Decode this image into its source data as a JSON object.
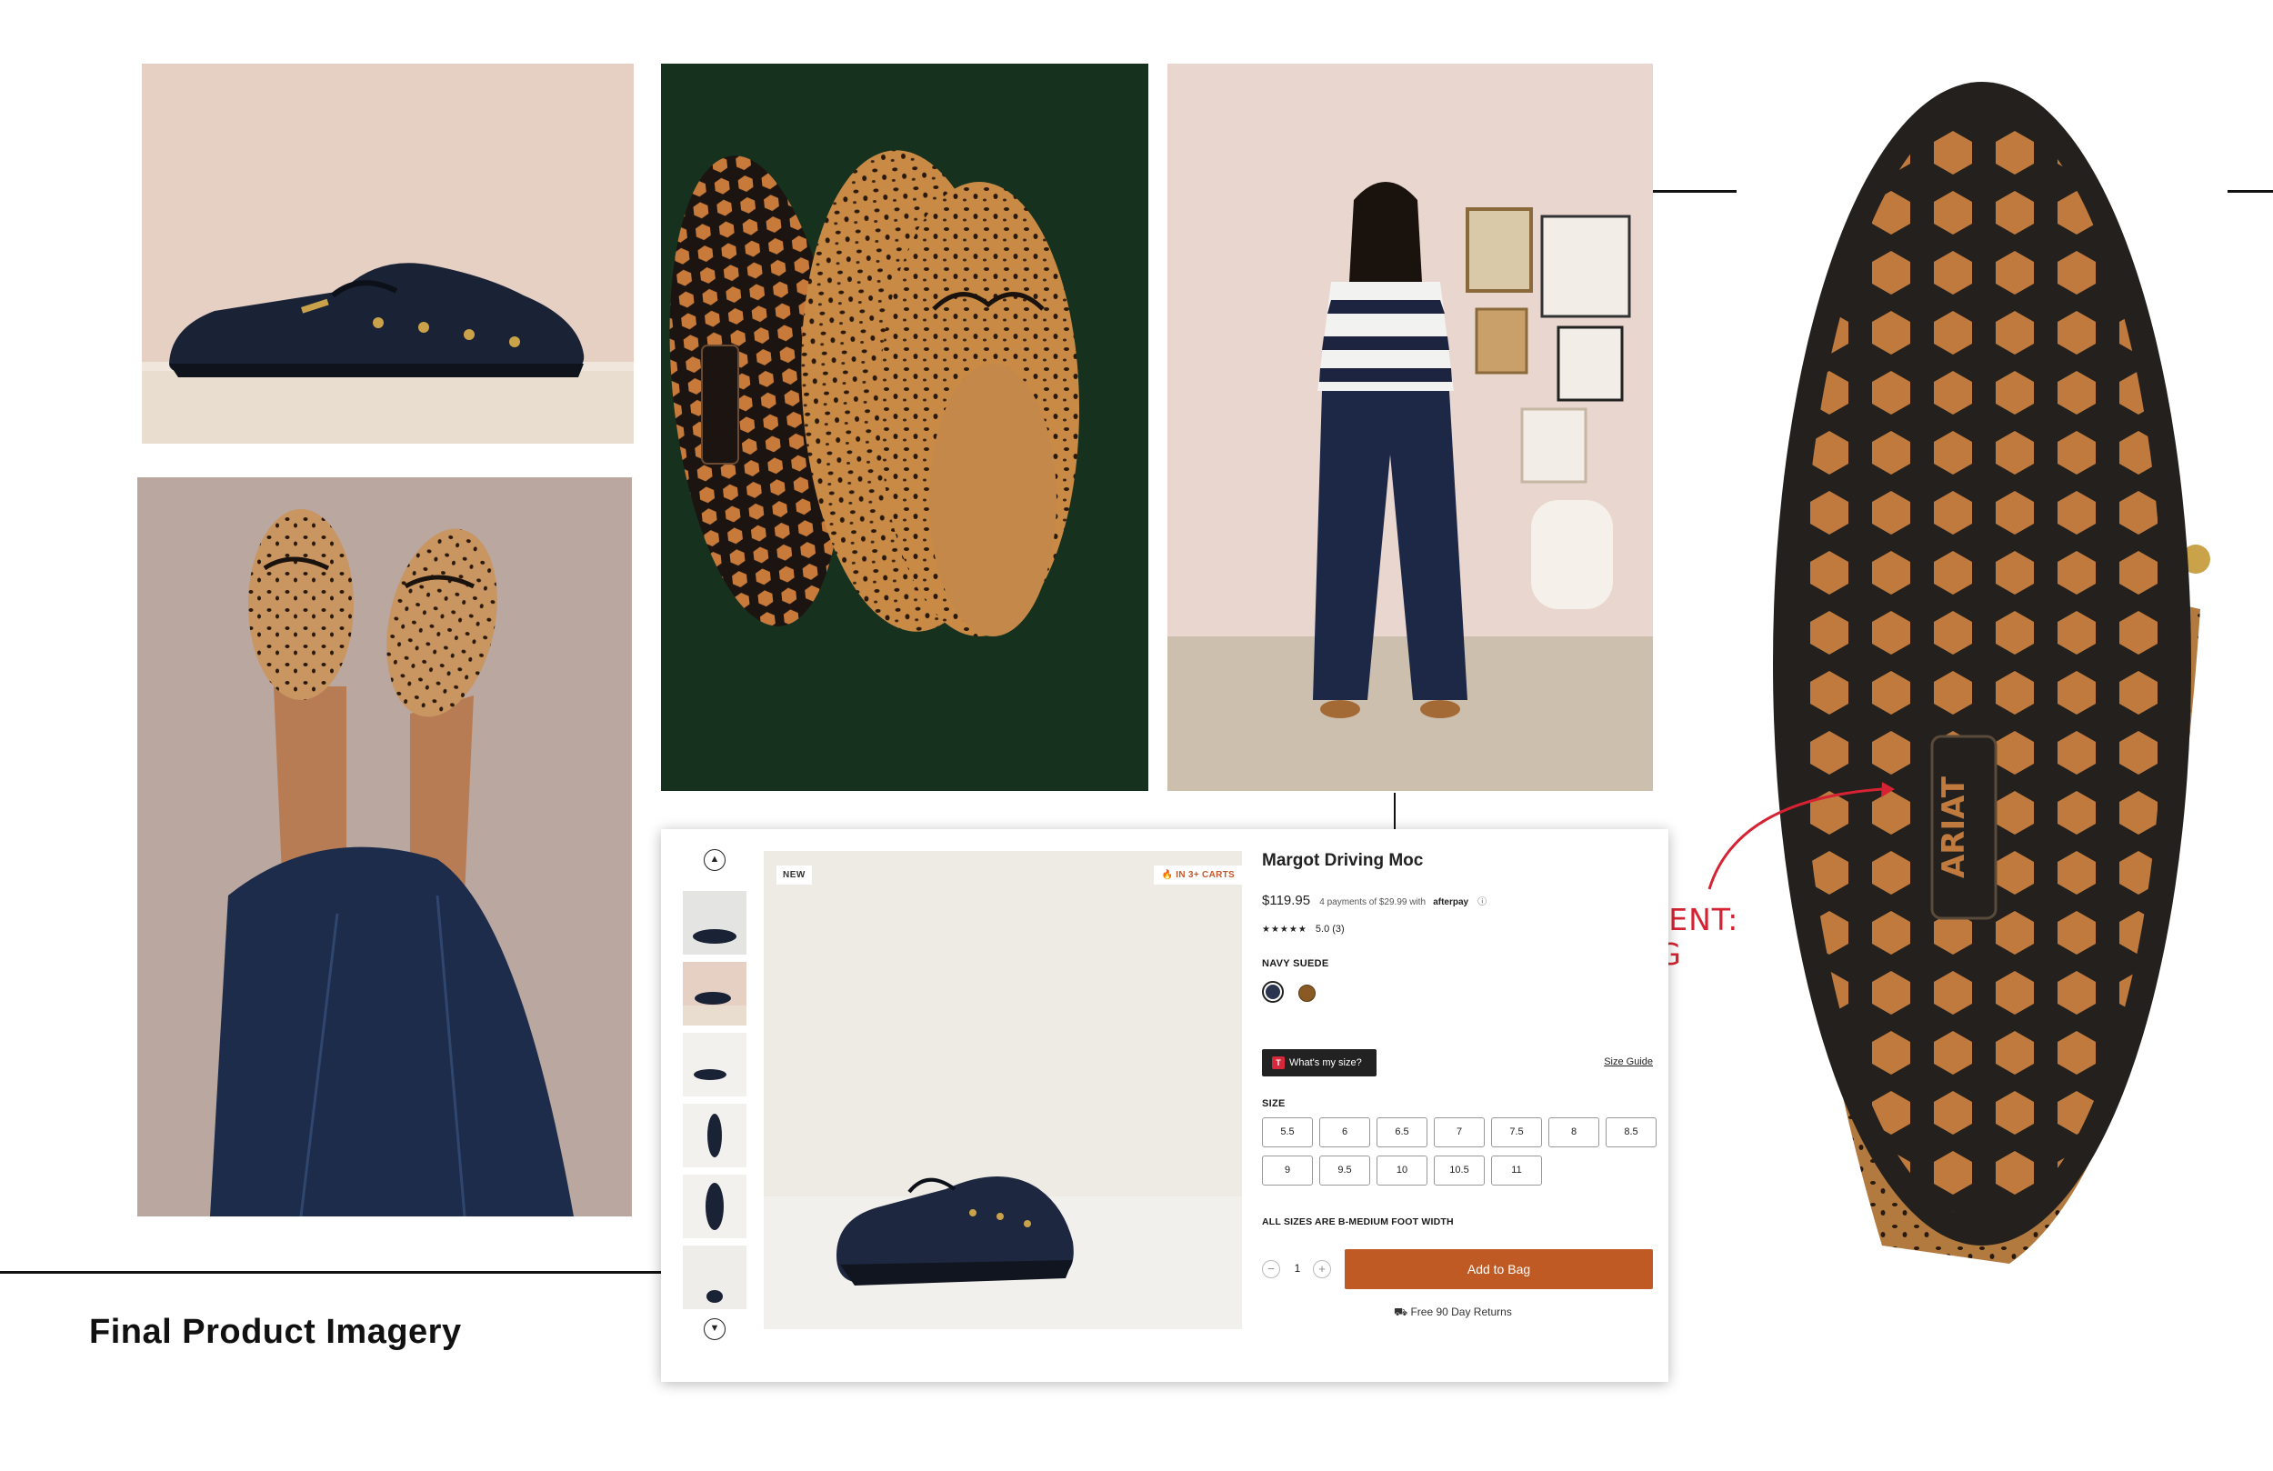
{
  "caption": "Final Product Imagery",
  "callout": {
    "line1": "DESIGN PATENT:",
    "line2": "PENDING",
    "color": "#d62333"
  },
  "photos": [
    {
      "name": "navy-moc-side-photo"
    },
    {
      "name": "leopard-moc-pair-photo"
    },
    {
      "name": "model-full-body-photo"
    },
    {
      "name": "legs-up-leopard-photo"
    },
    {
      "name": "leopard-sole-closeup-photo"
    }
  ],
  "sole_brand": "ARIAT",
  "product_page": {
    "badge_new": "NEW",
    "badge_carts": "IN 3+ CARTS",
    "title": "Margot Driving Moc",
    "price": "$119.95",
    "installments": "4 payments of $29.99 with",
    "afterpay": "afterpay",
    "stars": "★★★★★",
    "rating": "5.0 (3)",
    "color_label": "NAVY SUEDE",
    "swatches": [
      {
        "name": "navy",
        "color": "#2b3550"
      },
      {
        "name": "leopard",
        "color": "#8a5a25"
      }
    ],
    "size_help": {
      "badge": "T",
      "label": "What's my size?"
    },
    "size_guide": "Size Guide",
    "size_label": "SIZE",
    "sizes": [
      "5.5",
      "6",
      "6.5",
      "7",
      "7.5",
      "8",
      "8.5",
      "9",
      "9.5",
      "10",
      "10.5",
      "11"
    ],
    "width_note": "ALL SIZES ARE B-MEDIUM FOOT WIDTH",
    "qty": {
      "minus": "−",
      "value": "1",
      "plus": "+"
    },
    "add_to_bag": "Add to Bag",
    "returns": "Free 90 Day Returns",
    "arrow_up": "▲",
    "arrow_down": "▼",
    "accent_color": "#c05a24"
  }
}
